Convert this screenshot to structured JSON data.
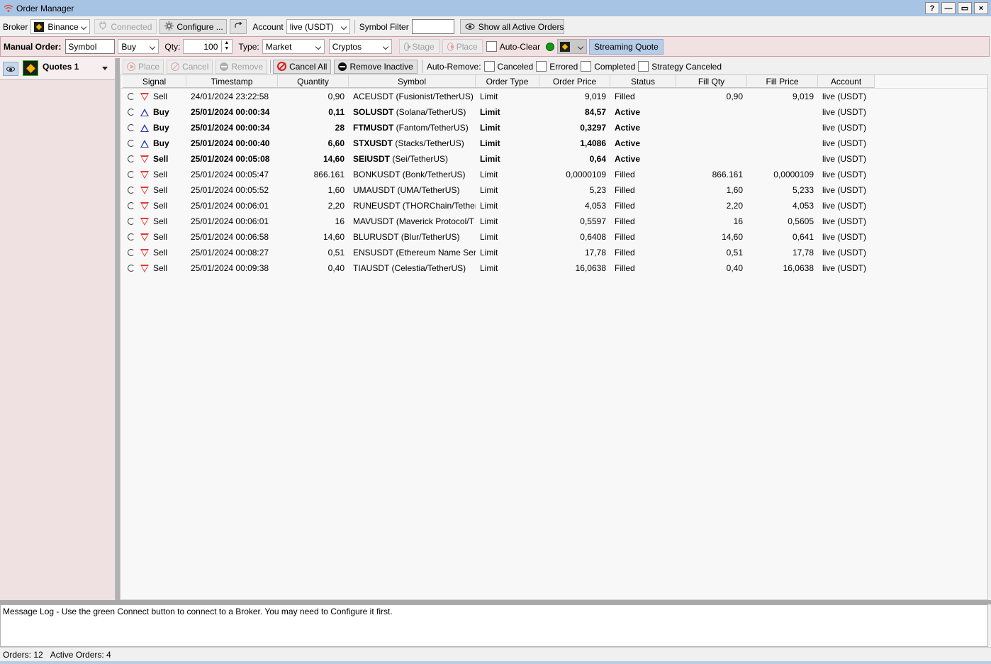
{
  "window": {
    "title": "Order Manager",
    "help": "?",
    "minimize": "—",
    "maximize": "▭",
    "close": "×"
  },
  "broker_bar": {
    "broker_label": "Broker",
    "broker_value": "Binance",
    "connected_label": "Connected",
    "configure_label": "Configure ...",
    "account_label": "Account",
    "account_value": "live (USDT)",
    "symbol_filter_label": "Symbol Filter",
    "symbol_filter_value": "",
    "show_all_label": "Show all Active Orders"
  },
  "manual_order": {
    "label": "Manual Order:",
    "symbol_value": "Symbol",
    "side_value": "Buy",
    "qty_label": "Qty:",
    "qty_value": "100",
    "type_label": "Type:",
    "type_value": "Market",
    "asset_value": "Cryptos",
    "stage_label": "Stage",
    "place_label": "Place",
    "auto_clear_label": "Auto-Clear",
    "streaming_label": "Streaming Quote"
  },
  "left_panel": {
    "quotes_label": "Quotes 1"
  },
  "orders_toolbar": {
    "place_label": "Place",
    "cancel_label": "Cancel",
    "remove_label": "Remove",
    "cancel_all_label": "Cancel All",
    "remove_inactive_label": "Remove Inactive",
    "auto_remove_label": "Auto-Remove:",
    "canceled_label": "Canceled",
    "errored_label": "Errored",
    "completed_label": "Completed",
    "strategy_canceled_label": "Strategy Canceled"
  },
  "grid": {
    "columns": [
      "Signal",
      "Timestamp",
      "Quantity",
      "Symbol",
      "Order Type",
      "Order Price",
      "Status",
      "Fill Qty",
      "Fill Price",
      "Account"
    ],
    "rows": [
      {
        "signal": "Sell",
        "timestamp": "24/01/2024 23:22:58",
        "quantity": "0,90",
        "symbol": "ACEUSDT (Fusionist/TetherUS)",
        "order_type": "Limit",
        "order_price": "9,019",
        "status": "Filled",
        "fill_qty": "0,90",
        "fill_price": "9,019",
        "account": "live (USDT)"
      },
      {
        "signal": "Buy",
        "timestamp": "25/01/2024 00:00:34",
        "quantity": "0,11",
        "symbol_code": "SOLUSDT",
        "symbol_name": "(Solana/TetherUS)",
        "order_type": "Limit",
        "order_price": "84,57",
        "status": "Active",
        "fill_qty": "",
        "fill_price": "",
        "account": "live (USDT)"
      },
      {
        "signal": "Buy",
        "timestamp": "25/01/2024 00:00:34",
        "quantity": "28",
        "symbol_code": "FTMUSDT",
        "symbol_name": "(Fantom/TetherUS)",
        "order_type": "Limit",
        "order_price": "0,3297",
        "status": "Active",
        "fill_qty": "",
        "fill_price": "",
        "account": "live (USDT)"
      },
      {
        "signal": "Buy",
        "timestamp": "25/01/2024 00:00:40",
        "quantity": "6,60",
        "symbol_code": "STXUSDT",
        "symbol_name": "(Stacks/TetherUS)",
        "order_type": "Limit",
        "order_price": "1,4086",
        "status": "Active",
        "fill_qty": "",
        "fill_price": "",
        "account": "live (USDT)"
      },
      {
        "signal": "Sell",
        "timestamp": "25/01/2024 00:05:08",
        "quantity": "14,60",
        "symbol_code": "SEIUSDT",
        "symbol_name": "(Sei/TetherUS)",
        "order_type": "Limit",
        "order_price": "0,64",
        "status": "Active",
        "fill_qty": "",
        "fill_price": "",
        "account": "live (USDT)"
      },
      {
        "signal": "Sell",
        "timestamp": "25/01/2024 00:05:47",
        "quantity": "866.161",
        "symbol": "BONKUSDT (Bonk/TetherUS)",
        "order_type": "Limit",
        "order_price": "0,0000109",
        "status": "Filled",
        "fill_qty": "866.161",
        "fill_price": "0,0000109",
        "account": "live (USDT)"
      },
      {
        "signal": "Sell",
        "timestamp": "25/01/2024 00:05:52",
        "quantity": "1,60",
        "symbol": "UMAUSDT (UMA/TetherUS)",
        "order_type": "Limit",
        "order_price": "5,23",
        "status": "Filled",
        "fill_qty": "1,60",
        "fill_price": "5,233",
        "account": "live (USDT)"
      },
      {
        "signal": "Sell",
        "timestamp": "25/01/2024 00:06:01",
        "quantity": "2,20",
        "symbol": "RUNEUSDT (THORChain/Tetherl",
        "order_type": "Limit",
        "order_price": "4,053",
        "status": "Filled",
        "fill_qty": "2,20",
        "fill_price": "4,053",
        "account": "live (USDT)"
      },
      {
        "signal": "Sell",
        "timestamp": "25/01/2024 00:06:01",
        "quantity": "16",
        "symbol": "MAVUSDT (Maverick Protocol/T",
        "order_type": "Limit",
        "order_price": "0,5597",
        "status": "Filled",
        "fill_qty": "16",
        "fill_price": "0,5605",
        "account": "live (USDT)"
      },
      {
        "signal": "Sell",
        "timestamp": "25/01/2024 00:06:58",
        "quantity": "14,60",
        "symbol": "BLURUSDT (Blur/TetherUS)",
        "order_type": "Limit",
        "order_price": "0,6408",
        "status": "Filled",
        "fill_qty": "14,60",
        "fill_price": "0,641",
        "account": "live (USDT)"
      },
      {
        "signal": "Sell",
        "timestamp": "25/01/2024 00:08:27",
        "quantity": "0,51",
        "symbol": "ENSUSDT (Ethereum Name Serv",
        "order_type": "Limit",
        "order_price": "17,78",
        "status": "Filled",
        "fill_qty": "0,51",
        "fill_price": "17,78",
        "account": "live (USDT)"
      },
      {
        "signal": "Sell",
        "timestamp": "25/01/2024 00:09:38",
        "quantity": "0,40",
        "symbol": "TIAUSDT (Celestia/TetherUS)",
        "order_type": "Limit",
        "order_price": "16,0638",
        "status": "Filled",
        "fill_qty": "0,40",
        "fill_price": "16,0638",
        "account": "live (USDT)"
      }
    ]
  },
  "message_log": "Message Log - Use the green Connect button to connect to a Broker. You may need to Configure it first.",
  "status_bar": {
    "orders": "Orders: 12",
    "active_orders": "Active Orders: 4"
  }
}
